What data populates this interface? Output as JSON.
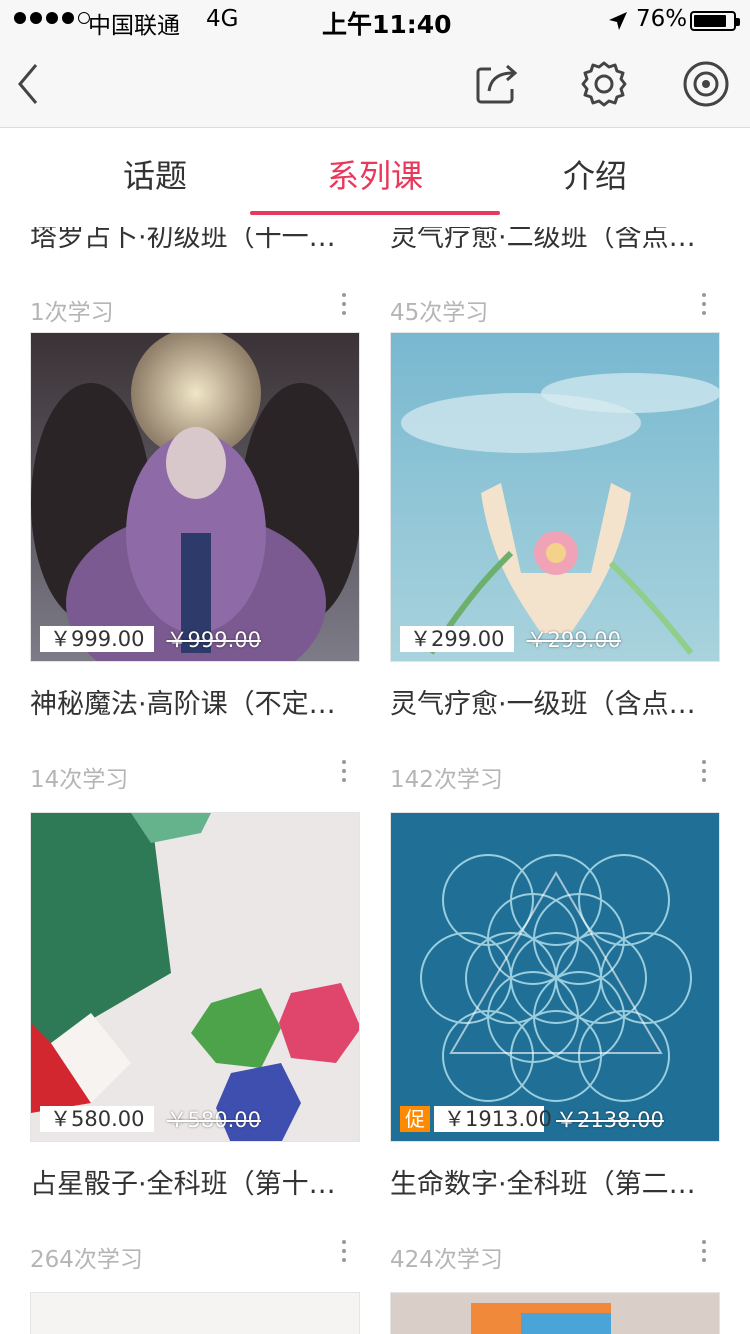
{
  "status_bar": {
    "carrier": "中国联通",
    "network": "4G",
    "time": "上午11:40",
    "battery": "76%",
    "battery_level": 0.76
  },
  "nav": {
    "icons": [
      "back-icon",
      "share-icon",
      "gear-icon",
      "radio-icon"
    ]
  },
  "tabs": [
    {
      "label": "话题",
      "active": false
    },
    {
      "label": "系列课",
      "active": true
    },
    {
      "label": "介绍",
      "active": false
    }
  ],
  "accent_color": "#e8395c",
  "courses": [
    {
      "title": "塔罗占卜·初级班（十一期）",
      "learn": "1次学习"
    },
    {
      "title": "灵气疗愈·二级班（含点化）",
      "learn": "45次学习"
    },
    {
      "title": "神秘魔法·高阶课（不定时开课）",
      "learn": "14次学习",
      "price": "￥999.00",
      "orig_price": "￥999.00"
    },
    {
      "title": "灵气疗愈·一级班（含点化）",
      "learn": "142次学习",
      "price": "￥299.00",
      "orig_price": "￥299.00"
    },
    {
      "title": "占星骰子·全科班（第十期）",
      "learn": "264次学习",
      "price": "￥580.00",
      "orig_price": "￥580.00"
    },
    {
      "title": "生命数字·全科班（第二期）",
      "learn": "424次学习",
      "price": "￥1913.00",
      "orig_price": "￥2138.00",
      "promo": "促"
    }
  ]
}
